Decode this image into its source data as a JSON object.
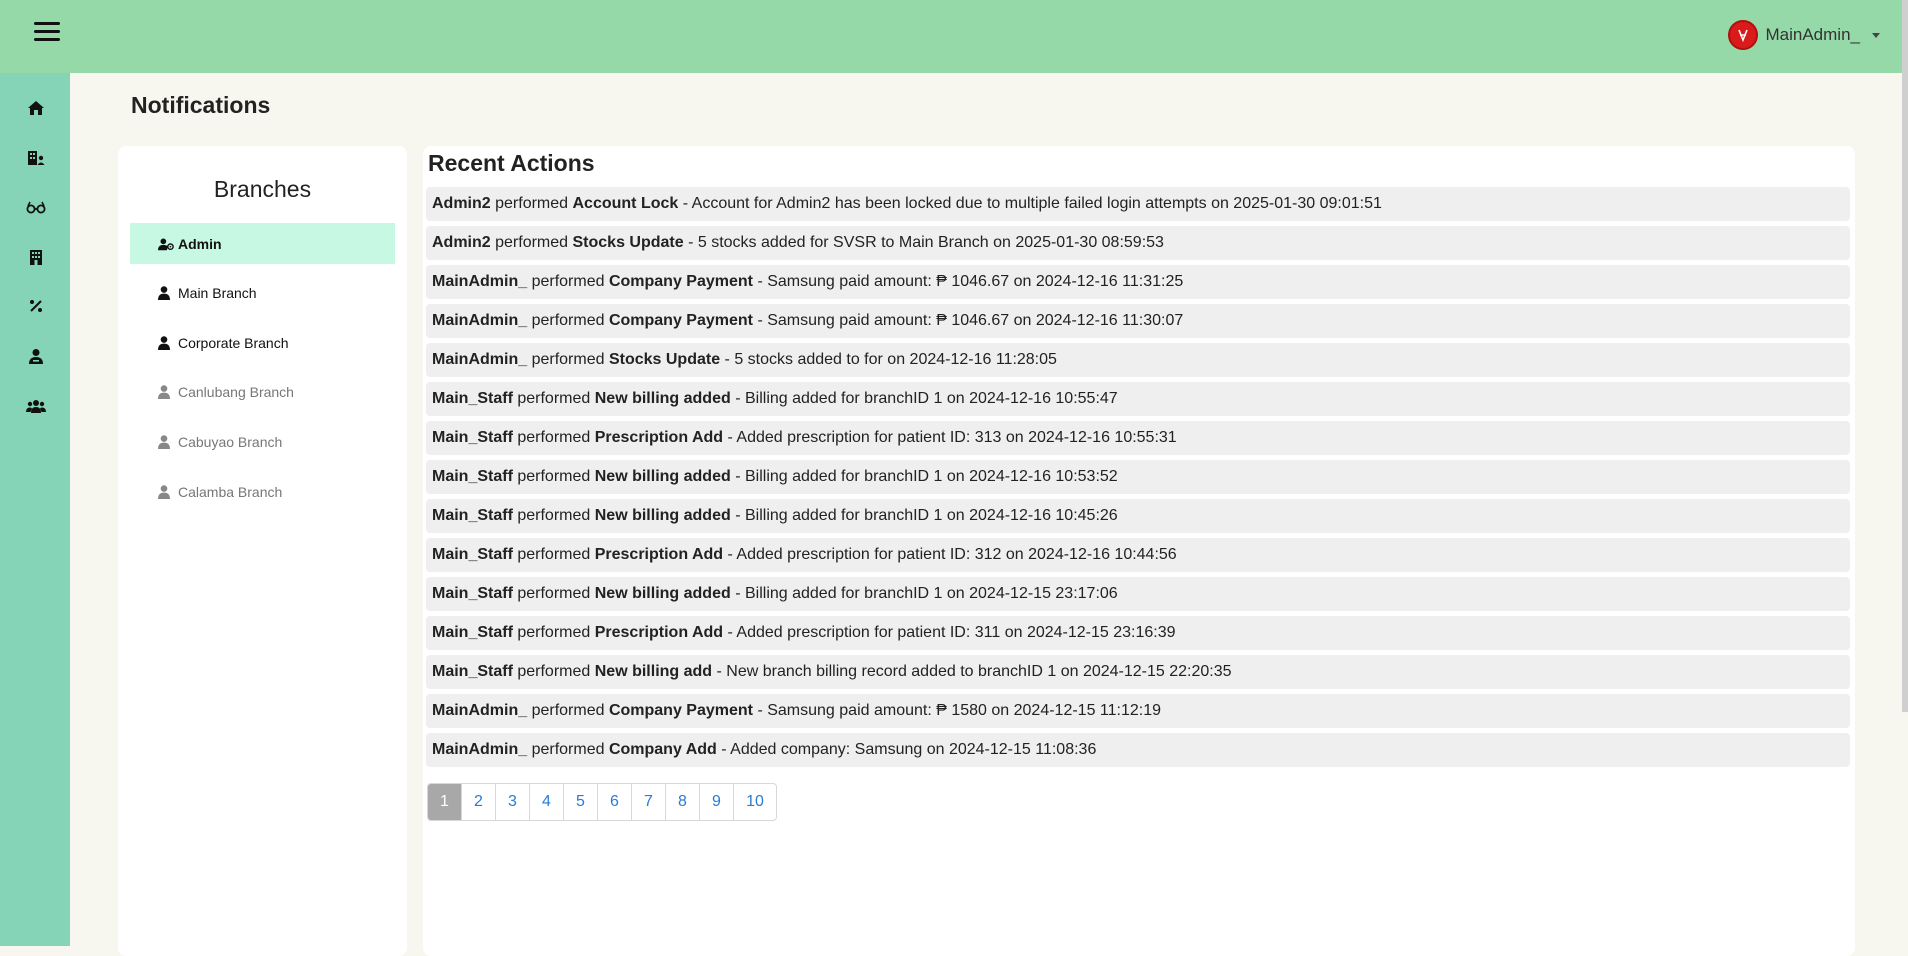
{
  "header": {
    "user_name": "MainAdmin_"
  },
  "sidebar": {
    "icons": [
      "home-icon",
      "building-user-icon",
      "glasses-icon",
      "building-icon",
      "percent-icon",
      "user-doctor-icon",
      "users-icon"
    ]
  },
  "page": {
    "title": "Notifications"
  },
  "branches": {
    "title": "Branches",
    "items": [
      {
        "label": "Admin",
        "state": "active"
      },
      {
        "label": "Main Branch",
        "state": "enabled"
      },
      {
        "label": "Corporate Branch",
        "state": "enabled"
      },
      {
        "label": "Canlubang Branch",
        "state": "disabled"
      },
      {
        "label": "Cabuyao Branch",
        "state": "disabled"
      },
      {
        "label": "Calamba Branch",
        "state": "disabled"
      }
    ]
  },
  "recent_actions": {
    "title": "Recent Actions",
    "connector": "performed",
    "rows": [
      {
        "user": "Admin2",
        "action": "Account Lock",
        "detail": "- Account for Admin2 has been locked due to multiple failed login attempts on 2025-01-30 09:01:51"
      },
      {
        "user": "Admin2",
        "action": "Stocks Update",
        "detail": "- 5 stocks added for SVSR to Main Branch on 2025-01-30 08:59:53"
      },
      {
        "user": "MainAdmin_",
        "action": "Company Payment",
        "detail": "- Samsung paid amount: ₱ 1046.67 on 2024-12-16 11:31:25"
      },
      {
        "user": "MainAdmin_",
        "action": "Company Payment",
        "detail": "- Samsung paid amount: ₱ 1046.67 on 2024-12-16 11:30:07"
      },
      {
        "user": "MainAdmin_",
        "action": "Stocks Update",
        "detail": "- 5 stocks added to for on 2024-12-16 11:28:05"
      },
      {
        "user": "Main_Staff",
        "action": "New billing added",
        "detail": "- Billing added for branchID 1 on 2024-12-16 10:55:47"
      },
      {
        "user": "Main_Staff",
        "action": "Prescription Add",
        "detail": "- Added prescription for patient ID: 313 on 2024-12-16 10:55:31"
      },
      {
        "user": "Main_Staff",
        "action": "New billing added",
        "detail": "- Billing added for branchID 1 on 2024-12-16 10:53:52"
      },
      {
        "user": "Main_Staff",
        "action": "New billing added",
        "detail": "- Billing added for branchID 1 on 2024-12-16 10:45:26"
      },
      {
        "user": "Main_Staff",
        "action": "Prescription Add",
        "detail": "- Added prescription for patient ID: 312 on 2024-12-16 10:44:56"
      },
      {
        "user": "Main_Staff",
        "action": "New billing added",
        "detail": "- Billing added for branchID 1 on 2024-12-15 23:17:06"
      },
      {
        "user": "Main_Staff",
        "action": "Prescription Add",
        "detail": "- Added prescription for patient ID: 311 on 2024-12-15 23:16:39"
      },
      {
        "user": "Main_Staff",
        "action": "New billing add",
        "detail": "- New branch billing record added to branchID 1 on 2024-12-15 22:20:35"
      },
      {
        "user": "MainAdmin_",
        "action": "Company Payment",
        "detail": "- Samsung paid amount: ₱ 1580 on 2024-12-15 11:12:19"
      },
      {
        "user": "MainAdmin_",
        "action": "Company Add",
        "detail": "- Added company: Samsung on 2024-12-15 11:08:36"
      }
    ]
  },
  "pagination": {
    "current": "1",
    "pages": [
      "1",
      "2",
      "3",
      "4",
      "5",
      "6",
      "7",
      "8",
      "9",
      "10"
    ]
  },
  "colors": {
    "topbar": "#95d9a8",
    "sidebar": "#86d4b8",
    "active_branch": "#c6f8e4",
    "page_link": "#2a7bd5"
  }
}
